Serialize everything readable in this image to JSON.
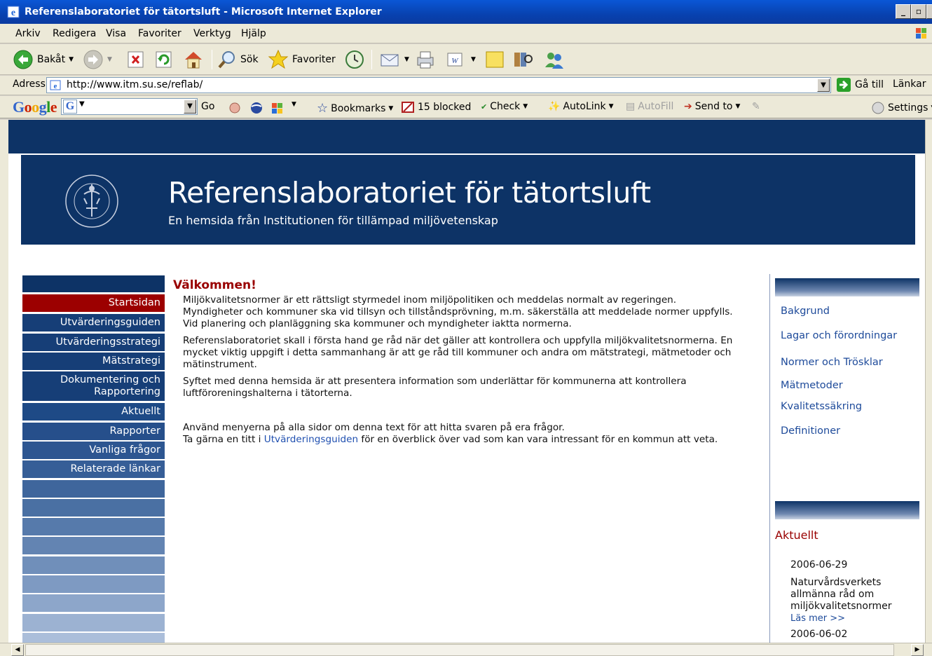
{
  "window": {
    "title": "Referenslaboratoriet för tätortsluft - Microsoft Internet Explorer"
  },
  "menu": {
    "items": [
      "Arkiv",
      "Redigera",
      "Visa",
      "Favoriter",
      "Verktyg",
      "Hjälp"
    ]
  },
  "toolbar": {
    "back_label": "Bakåt",
    "search_label": "Sök",
    "favorites_label": "Favoriter"
  },
  "address": {
    "label": "Adress",
    "url": "http://www.itm.su.se/reflab/",
    "go_label": "Gå till",
    "links_label": "Länkar"
  },
  "googlebar": {
    "logo": "Google",
    "go_label": "Go",
    "bookmarks_label": "Bookmarks",
    "blocked_label": "15 blocked",
    "check_label": "Check",
    "autolink_label": "AutoLink",
    "autofill_label": "AutoFill",
    "sendto_label": "Send to",
    "settings_label": "Settings"
  },
  "site": {
    "title": "Referenslaboratoriet för tätortsluft",
    "subtitle": "En hemsida från Institutionen för tillämpad miljövetenskap"
  },
  "nav": {
    "items": [
      {
        "label": "Startsidan"
      },
      {
        "label": "Utvärderingsguiden"
      },
      {
        "label": "Utvärderingsstrategi"
      },
      {
        "label": "Mätstrategi"
      },
      {
        "label": "Dokumentering och",
        "label2": "Rapportering"
      },
      {
        "label": "Aktuellt"
      },
      {
        "label": "Rapporter"
      },
      {
        "label": "Vanliga frågor"
      },
      {
        "label": "Relaterade länkar"
      }
    ]
  },
  "main": {
    "heading": "Välkommen!",
    "p1": "Miljökvalitetsnormer är ett rättsligt styrmedel inom miljöpolitiken och meddelas normalt av regeringen. Myndigheter och kommuner ska vid tillsyn och tillståndsprövning, m.m. säkerställa att meddelade normer uppfylls. Vid planering och planläggning ska kommuner och myndigheter iaktta normerna.",
    "p2": "Referenslaboratoriet skall i första hand ge råd när det gäller att kontrollera och uppfylla miljökvalitetsnormerna. En mycket viktig uppgift i detta sammanhang är att ge råd till kommuner och andra om mätstrategi, mätmetoder och mätinstrument.",
    "p3": "Syftet med denna hemsida är att presentera information som underlättar för kommunerna att kontrollera luftföroreningshalterna i tätorterna.",
    "p4": "Använd menyerna på alla sidor om denna text för att hitta svaren på era frågor.",
    "p5_before": "Ta gärna en titt i ",
    "p5_link": "Utvärderingsguiden",
    "p5_after": " för en överblick över vad som kan vara intressant för en kommun att veta."
  },
  "right": {
    "links": [
      "Bakgrund",
      "Lagar och förordningar",
      "Normer och Trösklar",
      "Mätmetoder",
      "Kvalitetssäkring",
      "Definitioner"
    ],
    "aktuellt_title": "Aktuellt",
    "news1_date": "2006-06-29",
    "news1_text": "Naturvårdsverkets allmänna råd om miljökvalitetsnormer",
    "news1_more": "Läs mer >>",
    "news2_date": "2006-06-02"
  }
}
